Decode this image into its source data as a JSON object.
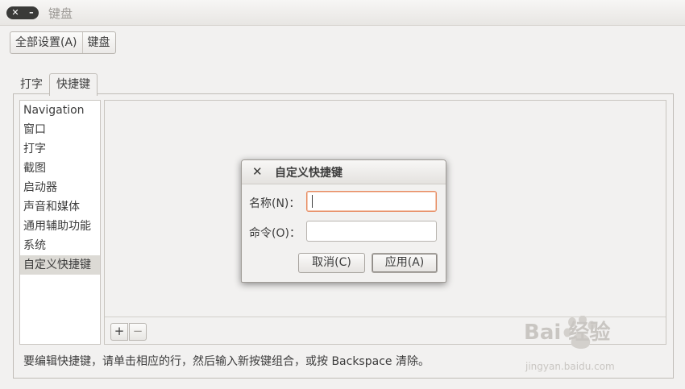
{
  "window": {
    "title": "键盘",
    "close_glyph": "✕",
    "minimize_glyph": "–"
  },
  "breadcrumb": {
    "items": [
      "全部设置(A)",
      "键盘"
    ]
  },
  "tabs": [
    {
      "label": "打字",
      "active": false
    },
    {
      "label": "快捷键",
      "active": true
    }
  ],
  "sidebar": {
    "items": [
      "Navigation",
      "窗口",
      "打字",
      "截图",
      "启动器",
      "声音和媒体",
      "通用辅助功能",
      "系统",
      "自定义快捷键"
    ],
    "selected": "自定义快捷键"
  },
  "toolbar": {
    "add_label": "+",
    "remove_label": "−"
  },
  "hint": "要编辑快捷键，请单击相应的行，然后输入新按键组合，或按 Backspace 清除。",
  "dialog": {
    "title": "自定义快捷键",
    "close_glyph": "✕",
    "name_label": "名称(N)：",
    "name_value": "",
    "command_label": "命令(O)：",
    "command_value": "",
    "cancel_label": "取消(C)",
    "apply_label": "应用(A)"
  },
  "watermark": {
    "text": "Bai  经验",
    "sub": "jingyan.baidu.com"
  },
  "colors": {
    "focus": "#e88a5f",
    "window_bg": "#f2f1f0",
    "selected_row": "#dcdad5"
  }
}
